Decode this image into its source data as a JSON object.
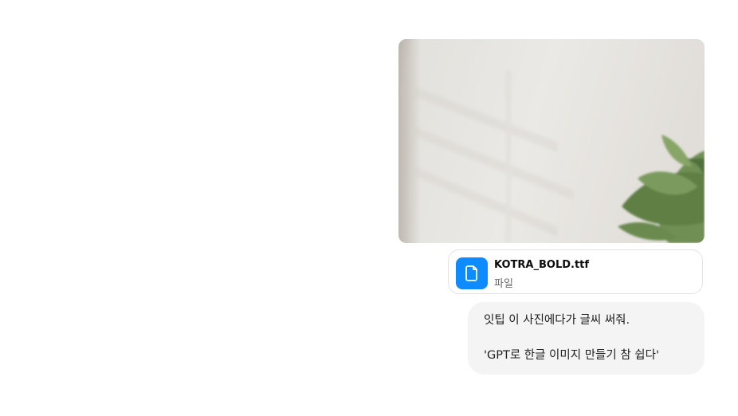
{
  "conversation": {
    "attachment": {
      "image_alt": "",
      "file": {
        "name": "KOTRA_BOLD.ttf",
        "type": "파일",
        "icon": "document-icon",
        "icon_bg_color": "#0d8bff"
      }
    },
    "user_message": {
      "line_1": "잇팁 이 사진에다가 글씨 써줘.",
      "line_2": "'GPT로 한글 이미지 만들기 참 쉽다'",
      "bubble_color": "#f4f4f4"
    }
  }
}
